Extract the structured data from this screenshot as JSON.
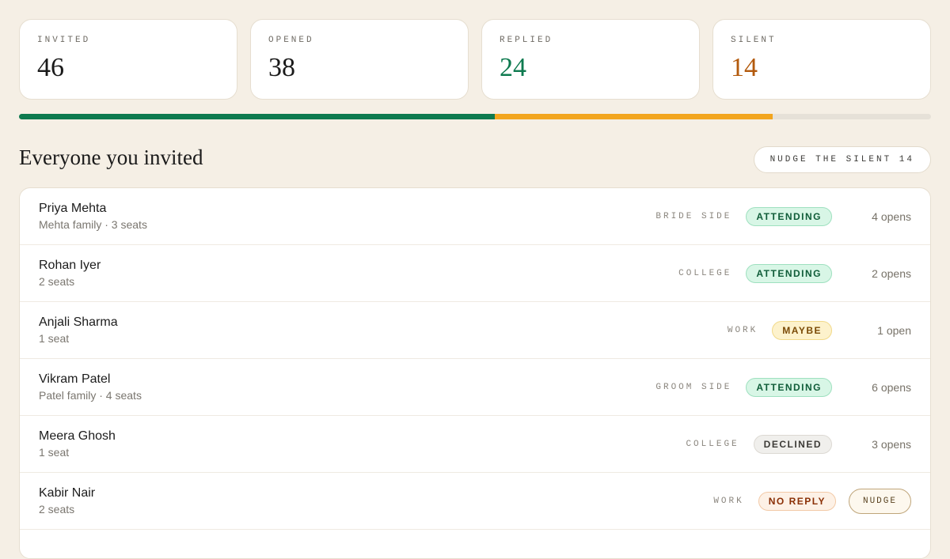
{
  "stats": {
    "invited": {
      "label": "INVITED",
      "value": "46",
      "color": "#1a1a1a"
    },
    "opened": {
      "label": "OPENED",
      "value": "38",
      "color": "#1a1a1a"
    },
    "replied": {
      "label": "REPLIED",
      "value": "24",
      "color": "#0e7a4f"
    },
    "silent": {
      "label": "SILENT",
      "value": "14",
      "color": "#b35a0d"
    }
  },
  "progress": {
    "replied_fraction": 0.522,
    "opened_unreplied_fraction": 0.304,
    "replied_color": "#0e7a4f",
    "opened_color": "#f2a51e"
  },
  "section": {
    "title": "Everyone you invited",
    "nudge_all_label": "NUDGE THE SILENT 14"
  },
  "guests": [
    {
      "name": "Priya Mehta",
      "sub": "Mehta family · 3 seats",
      "side": "BRIDE SIDE",
      "status": "ATTENDING",
      "status_class": "attending",
      "opens": "4 opens"
    },
    {
      "name": "Rohan Iyer",
      "sub": "2 seats",
      "side": "COLLEGE",
      "status": "ATTENDING",
      "status_class": "attending",
      "opens": "2 opens"
    },
    {
      "name": "Anjali Sharma",
      "sub": "1 seat",
      "side": "WORK",
      "status": "MAYBE",
      "status_class": "maybe",
      "opens": "1 open"
    },
    {
      "name": "Vikram Patel",
      "sub": "Patel family · 4 seats",
      "side": "GROOM SIDE",
      "status": "ATTENDING",
      "status_class": "attending",
      "opens": "6 opens"
    },
    {
      "name": "Meera Ghosh",
      "sub": "1 seat",
      "side": "COLLEGE",
      "status": "DECLINED",
      "status_class": "declined",
      "opens": "3 opens"
    },
    {
      "name": "Kabir Nair",
      "sub": "2 seats",
      "side": "WORK",
      "status": "NO REPLY",
      "status_class": "noreply",
      "nudge_label": "NUDGE"
    }
  ]
}
